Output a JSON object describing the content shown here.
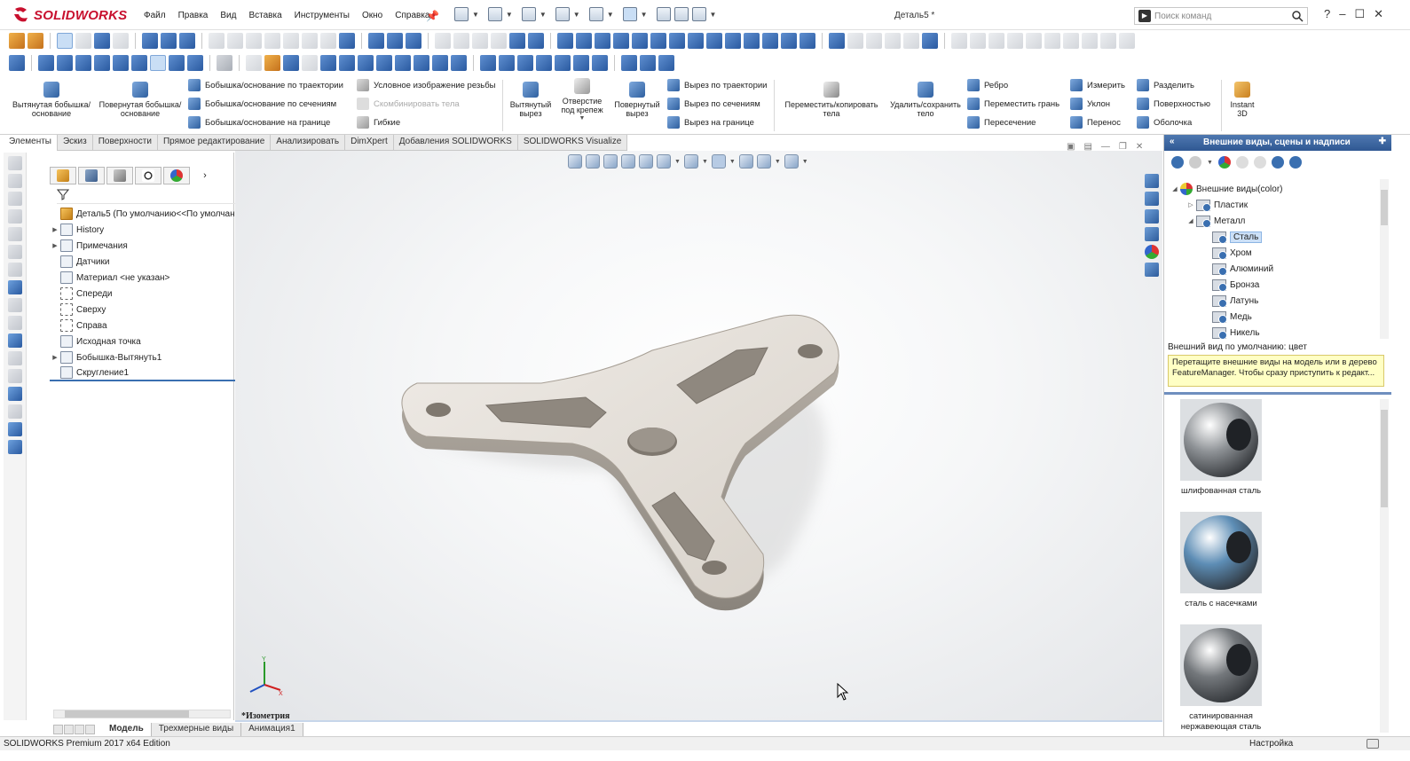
{
  "app": {
    "brand": "SOLIDWORKS",
    "document_title": "Деталь5 *",
    "accent": "#c8102e"
  },
  "menu": [
    "Файл",
    "Правка",
    "Вид",
    "Вставка",
    "Инструменты",
    "Окно",
    "Справка"
  ],
  "search": {
    "placeholder": "Поиск команд"
  },
  "window_controls": {
    "help": "?",
    "minimize": "–",
    "maximize": "☐",
    "close": "✕"
  },
  "ribbon": {
    "extrude_boss": "Вытянутая бобышка/основание",
    "revolve_boss": "Повернутая бобышка/основание",
    "sweep_boss": "Бобышка/основание по траектории",
    "loft_boss": "Бобышка/основание по сечениям",
    "boundary_boss": "Бобышка/основание на границе",
    "cosmetic_thread": "Условное изображение резьбы",
    "combine_bodies": "Скомбинировать тела",
    "flex": "Гибкие",
    "extruded_cut": "Вытянутый вырез",
    "hole_wizard": "Отверстие под крепеж",
    "revolved_cut": "Повернутый вырез",
    "swept_cut": "Вырез по траектории",
    "lofted_cut": "Вырез по сечениям",
    "boundary_cut": "Вырез на границе",
    "move_copy": "Переместить/копировать тела",
    "delete_keep": "Удалить/сохранить тело",
    "rib": "Ребро",
    "move_face": "Переместить грань",
    "intersect": "Пересечение",
    "measure": "Измерить",
    "draft": "Уклон",
    "wrap": "Перенос",
    "split": "Разделить",
    "surfaces": "Поверхностью",
    "shell": "Оболочка",
    "instant3d": "Instant 3D"
  },
  "command_tabs": [
    "Элементы",
    "Эскиз",
    "Поверхности",
    "Прямое редактирование",
    "Анализировать",
    "DimXpert",
    "Добавления SOLIDWORKS",
    "SOLIDWORKS Visualize"
  ],
  "feature_tree": {
    "root": "Деталь5  (По умолчанию<<По умолчан",
    "items": [
      {
        "label": "History",
        "expandable": true,
        "icon": "history-icon"
      },
      {
        "label": "Примечания",
        "expandable": true,
        "icon": "annotations-icon"
      },
      {
        "label": "Датчики",
        "expandable": false,
        "icon": "sensors-icon"
      },
      {
        "label": "Материал <не указан>",
        "expandable": false,
        "icon": "material-icon"
      },
      {
        "label": "Спереди",
        "expandable": false,
        "icon": "plane-icon"
      },
      {
        "label": "Сверху",
        "expandable": false,
        "icon": "plane-icon"
      },
      {
        "label": "Справа",
        "expandable": false,
        "icon": "plane-icon"
      },
      {
        "label": "Исходная точка",
        "expandable": false,
        "icon": "origin-icon"
      },
      {
        "label": "Бобышка-Вытянуть1",
        "expandable": true,
        "icon": "extrude-feature-icon"
      },
      {
        "label": "Скругление1",
        "expandable": false,
        "icon": "fillet-feature-icon"
      }
    ]
  },
  "viewport": {
    "view_name": "*Изометрия"
  },
  "bottom_tabs": [
    "Модель",
    "Трехмерные виды",
    "Анимация1"
  ],
  "status": {
    "edition": "SOLIDWORKS Premium 2017 x64 Edition",
    "settings": "Настройка"
  },
  "task_pane": {
    "title": "Внешние виды, сцены и надписи",
    "tree_root": "Внешние виды(color)",
    "tree": [
      {
        "label": "Пластик",
        "level": 1,
        "expanded": false
      },
      {
        "label": "Металл",
        "level": 1,
        "expanded": true
      },
      {
        "label": "Сталь",
        "level": 2,
        "selected": true
      },
      {
        "label": "Хром",
        "level": 2
      },
      {
        "label": "Алюминий",
        "level": 2
      },
      {
        "label": "Бронза",
        "level": 2
      },
      {
        "label": "Латунь",
        "level": 2
      },
      {
        "label": "Медь",
        "level": 2
      },
      {
        "label": "Никель",
        "level": 2
      }
    ],
    "default_appearance": "Внешний вид по умолчанию: цвет",
    "tip": "Перетащите внешние виды на модель или в дерево FeatureManager.  Чтобы сразу приступить к редакт...",
    "swatches": [
      {
        "label": "шлифованная сталь",
        "color": "#8e9296"
      },
      {
        "label": "сталь с насечками",
        "color": "#5d8db5"
      },
      {
        "label": "сатинированная нержавеющая сталь",
        "color": "#74787c"
      }
    ]
  }
}
